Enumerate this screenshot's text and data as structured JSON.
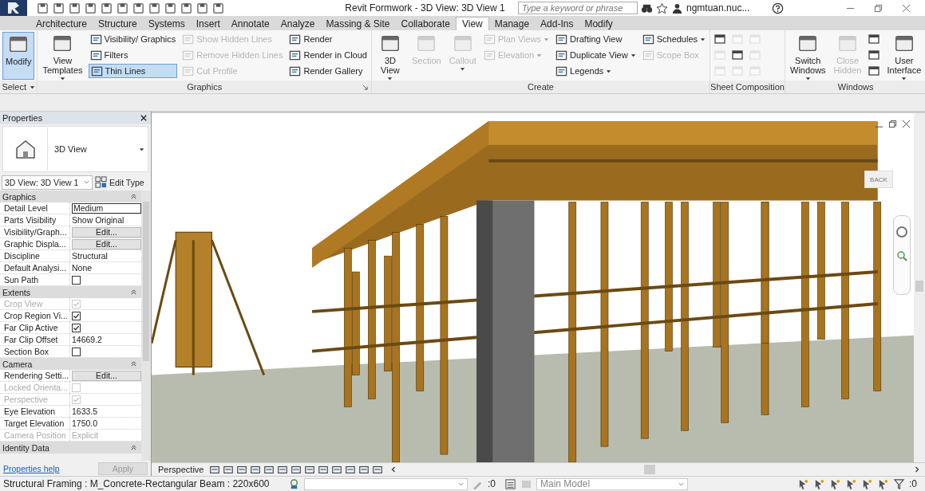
{
  "title_bar": {
    "title": "Revit Formwork - 3D View: 3D View 1",
    "search_placeholder": "Type a keyword or phrase",
    "user": "ngmtuan.nuc..."
  },
  "tabs": [
    {
      "label": "Architecture",
      "selected": false
    },
    {
      "label": "Structure",
      "selected": false
    },
    {
      "label": "Systems",
      "selected": false
    },
    {
      "label": "Insert",
      "selected": false
    },
    {
      "label": "Annotate",
      "selected": false
    },
    {
      "label": "Analyze",
      "selected": false
    },
    {
      "label": "Massing & Site",
      "selected": false
    },
    {
      "label": "Collaborate",
      "selected": false
    },
    {
      "label": "View",
      "selected": true
    },
    {
      "label": "Manage",
      "selected": false
    },
    {
      "label": "Add-Ins",
      "selected": false
    },
    {
      "label": "Modify",
      "selected": false
    }
  ],
  "ribbon": [
    {
      "name": "Select",
      "dropdown": true,
      "tools": [
        {
          "kind": "large",
          "label": "Modify",
          "active": true,
          "disabled": false,
          "dropdown": false
        }
      ]
    },
    {
      "name": "Graphics",
      "launcher": true,
      "tools": [
        {
          "kind": "large",
          "label": "View Templates",
          "active": false,
          "disabled": false,
          "dropdown": true
        },
        {
          "kind": "small",
          "label": "Visibility/ Graphics",
          "active": false,
          "disabled": false,
          "dropdown": false
        },
        {
          "kind": "small",
          "label": "Filters",
          "active": false,
          "disabled": false,
          "dropdown": false
        },
        {
          "kind": "small",
          "label": "Thin Lines",
          "active": true,
          "disabled": false,
          "dropdown": false
        },
        {
          "kind": "small",
          "label": "Show Hidden Lines",
          "active": false,
          "disabled": true,
          "dropdown": false
        },
        {
          "kind": "small",
          "label": "Remove Hidden Lines",
          "active": false,
          "disabled": true,
          "dropdown": false
        },
        {
          "kind": "small",
          "label": "Cut Profile",
          "active": false,
          "disabled": true,
          "dropdown": false
        },
        {
          "kind": "small",
          "label": "Render",
          "active": false,
          "disabled": false,
          "dropdown": false
        },
        {
          "kind": "small",
          "label": "Render in Cloud",
          "active": false,
          "disabled": false,
          "dropdown": false
        },
        {
          "kind": "small",
          "label": "Render Gallery",
          "active": false,
          "disabled": false,
          "dropdown": false
        }
      ]
    },
    {
      "name": "Create",
      "tools": [
        {
          "kind": "large",
          "label": "3D View",
          "active": false,
          "disabled": false,
          "dropdown": true
        },
        {
          "kind": "large",
          "label": "Section",
          "active": false,
          "disabled": true,
          "dropdown": false
        },
        {
          "kind": "large",
          "label": "Callout",
          "active": false,
          "disabled": true,
          "dropdown": true
        },
        {
          "kind": "small",
          "label": "Plan Views",
          "active": false,
          "disabled": true,
          "dropdown": true
        },
        {
          "kind": "small",
          "label": "Elevation",
          "active": false,
          "disabled": true,
          "dropdown": true
        },
        {
          "kind": "break"
        },
        {
          "kind": "small",
          "label": "Drafting View",
          "active": false,
          "disabled": false,
          "dropdown": false
        },
        {
          "kind": "small",
          "label": "Duplicate View",
          "active": false,
          "disabled": false,
          "dropdown": true
        },
        {
          "kind": "small",
          "label": "Legends",
          "active": false,
          "disabled": false,
          "dropdown": true
        },
        {
          "kind": "small",
          "label": "Schedules",
          "active": false,
          "disabled": false,
          "dropdown": true
        },
        {
          "kind": "small",
          "label": "Scope Box",
          "active": false,
          "disabled": true,
          "dropdown": false
        }
      ]
    },
    {
      "name": "Sheet Composition",
      "tools": [
        {
          "kind": "icon",
          "disabled": false
        },
        {
          "kind": "icon",
          "disabled": true
        },
        {
          "kind": "icon",
          "disabled": true
        },
        {
          "kind": "icon",
          "disabled": true
        },
        {
          "kind": "icon",
          "disabled": false
        },
        {
          "kind": "icon",
          "disabled": true
        },
        {
          "kind": "icon",
          "disabled": true
        },
        {
          "kind": "icon",
          "disabled": true
        },
        {
          "kind": "icon",
          "disabled": true
        }
      ]
    },
    {
      "name": "Windows",
      "tools": [
        {
          "kind": "large",
          "label": "Switch Windows",
          "active": false,
          "disabled": false,
          "dropdown": true
        },
        {
          "kind": "large",
          "label": "Close Hidden",
          "active": false,
          "disabled": true,
          "dropdown": false
        },
        {
          "kind": "icon",
          "disabled": false
        },
        {
          "kind": "icon",
          "disabled": false
        },
        {
          "kind": "icon",
          "disabled": false
        },
        {
          "kind": "large",
          "label": "User Interface",
          "active": false,
          "disabled": false,
          "dropdown": true
        }
      ]
    }
  ],
  "properties": {
    "title": "Properties",
    "type_name": "3D View",
    "view_selector": "3D View: 3D View 1",
    "edit_type": "Edit Type",
    "groups": [
      {
        "name": "Graphics",
        "rows": [
          {
            "label": "Detail Level",
            "kind": "field",
            "value": "Medium",
            "disabled": false
          },
          {
            "label": "Parts Visibility",
            "kind": "text",
            "value": "Show Original",
            "disabled": false
          },
          {
            "label": "Visibility/Graph...",
            "kind": "button",
            "value": "Edit...",
            "disabled": false
          },
          {
            "label": "Graphic Displa...",
            "kind": "button",
            "value": "Edit...",
            "disabled": false
          },
          {
            "label": "Discipline",
            "kind": "text",
            "value": "Structural",
            "disabled": false
          },
          {
            "label": "Default Analysi...",
            "kind": "text",
            "value": "None",
            "disabled": false
          },
          {
            "label": "Sun Path",
            "kind": "checkbox",
            "checked": false,
            "disabled": false
          }
        ]
      },
      {
        "name": "Extents",
        "rows": [
          {
            "label": "Crop View",
            "kind": "checkbox",
            "checked": true,
            "disabled": true
          },
          {
            "label": "Crop Region Vi...",
            "kind": "checkbox",
            "checked": true,
            "disabled": false
          },
          {
            "label": "Far Clip Active",
            "kind": "checkbox",
            "checked": true,
            "disabled": false
          },
          {
            "label": "Far Clip Offset",
            "kind": "text",
            "value": "14669.2",
            "disabled": false
          },
          {
            "label": "Section Box",
            "kind": "checkbox",
            "checked": false,
            "disabled": false
          }
        ]
      },
      {
        "name": "Camera",
        "rows": [
          {
            "label": "Rendering Setti...",
            "kind": "button",
            "value": "Edit...",
            "disabled": false
          },
          {
            "label": "Locked Orienta...",
            "kind": "checkbox",
            "checked": false,
            "disabled": true
          },
          {
            "label": "Perspective",
            "kind": "checkbox",
            "checked": true,
            "disabled": true
          },
          {
            "label": "Eye Elevation",
            "kind": "text",
            "value": "1633.5",
            "disabled": false
          },
          {
            "label": "Target Elevation",
            "kind": "text",
            "value": "1750.0",
            "disabled": false
          },
          {
            "label": "Camera Position",
            "kind": "text",
            "value": "Explicit",
            "disabled": true
          }
        ]
      },
      {
        "name": "Identity Data"
      }
    ],
    "help_link": "Properties help",
    "apply": {
      "label": "Apply",
      "disabled": true
    }
  },
  "view": {
    "view_cube": "BACK",
    "view_control": "Perspective"
  },
  "status_bar": {
    "selection": "Structural Framing : M_Concrete-Rectangular Beam : 220x600",
    "worksets_count": ":0",
    "model": "Main Model",
    "filter_count": ":0"
  }
}
